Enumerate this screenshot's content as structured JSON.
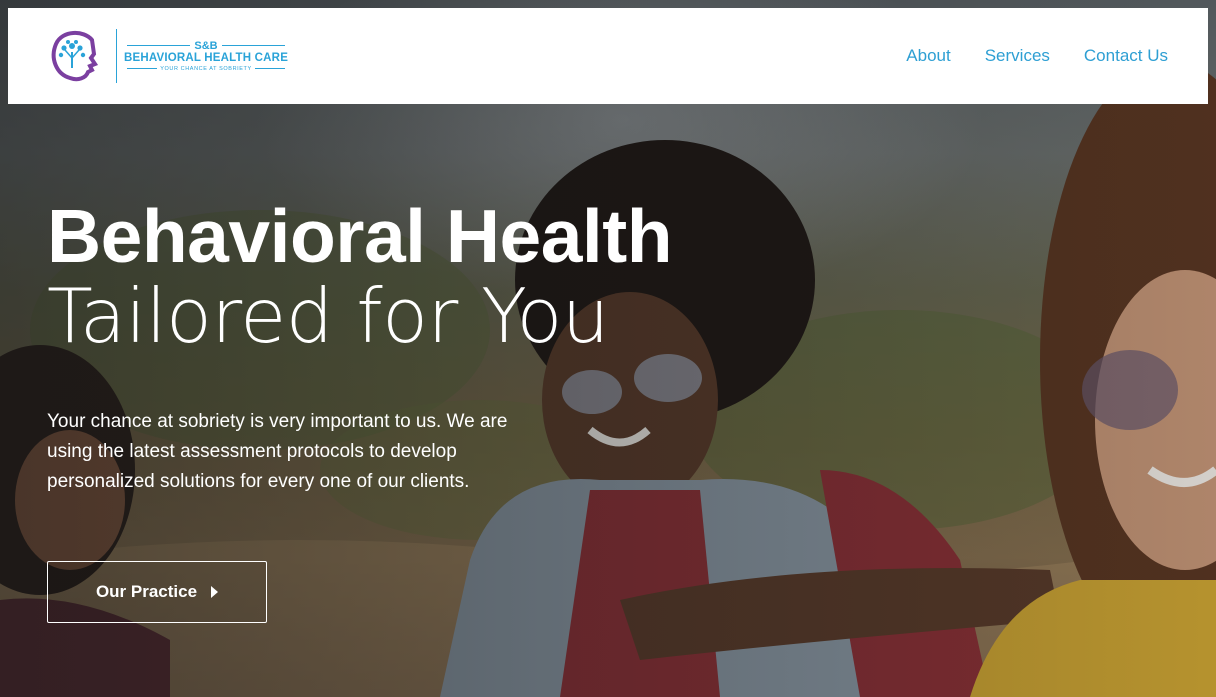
{
  "brand": {
    "top_text": "S&B",
    "name": "BEHAVIORAL HEALTH CARE",
    "tagline": "YOUR CHANCE AT SOBRIETY"
  },
  "nav": {
    "items": [
      {
        "label": "About"
      },
      {
        "label": "Services"
      },
      {
        "label": "Contact Us"
      }
    ]
  },
  "hero": {
    "title_line1": "Behavioral Health",
    "title_line2": "Tailored for You",
    "description": "Your chance at sobriety is very important to us. We are using the latest assessment protocols to develop personalized solutions for every one of our clients.",
    "cta_label": "Our Practice",
    "background_photo": "three smiling people sitting outdoors on sand"
  },
  "colors": {
    "brand_blue": "#2aa3d8",
    "brand_purple": "#7b3fa0",
    "header_bg": "#ffffff",
    "hero_text": "#ffffff"
  }
}
